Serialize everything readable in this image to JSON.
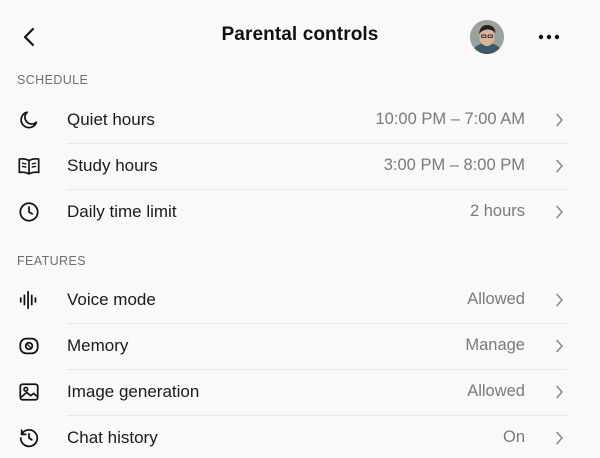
{
  "header": {
    "title": "Parental controls"
  },
  "sections": [
    {
      "label": "SCHEDULE",
      "items": [
        {
          "label": "Quiet hours",
          "value": "10:00 PM – 7:00 AM",
          "icon": "moon-icon"
        },
        {
          "label": "Study hours",
          "value": "3:00 PM – 8:00 PM",
          "icon": "book-icon"
        },
        {
          "label": "Daily time limit",
          "value": "2 hours",
          "icon": "clock-icon"
        }
      ]
    },
    {
      "label": "FEATURES",
      "items": [
        {
          "label": "Voice mode",
          "value": "Allowed",
          "icon": "waveform-icon"
        },
        {
          "label": "Memory",
          "value": "Manage",
          "icon": "memory-icon"
        },
        {
          "label": "Image generation",
          "value": "Allowed",
          "icon": "image-icon"
        },
        {
          "label": "Chat history",
          "value": "On",
          "icon": "history-icon"
        }
      ]
    }
  ],
  "colors": {
    "background": "#f9f9f9",
    "text": "#111111",
    "secondary_text": "#7a7a7a",
    "section_label": "#6e6e6e",
    "divider": "#e8e8e8"
  }
}
